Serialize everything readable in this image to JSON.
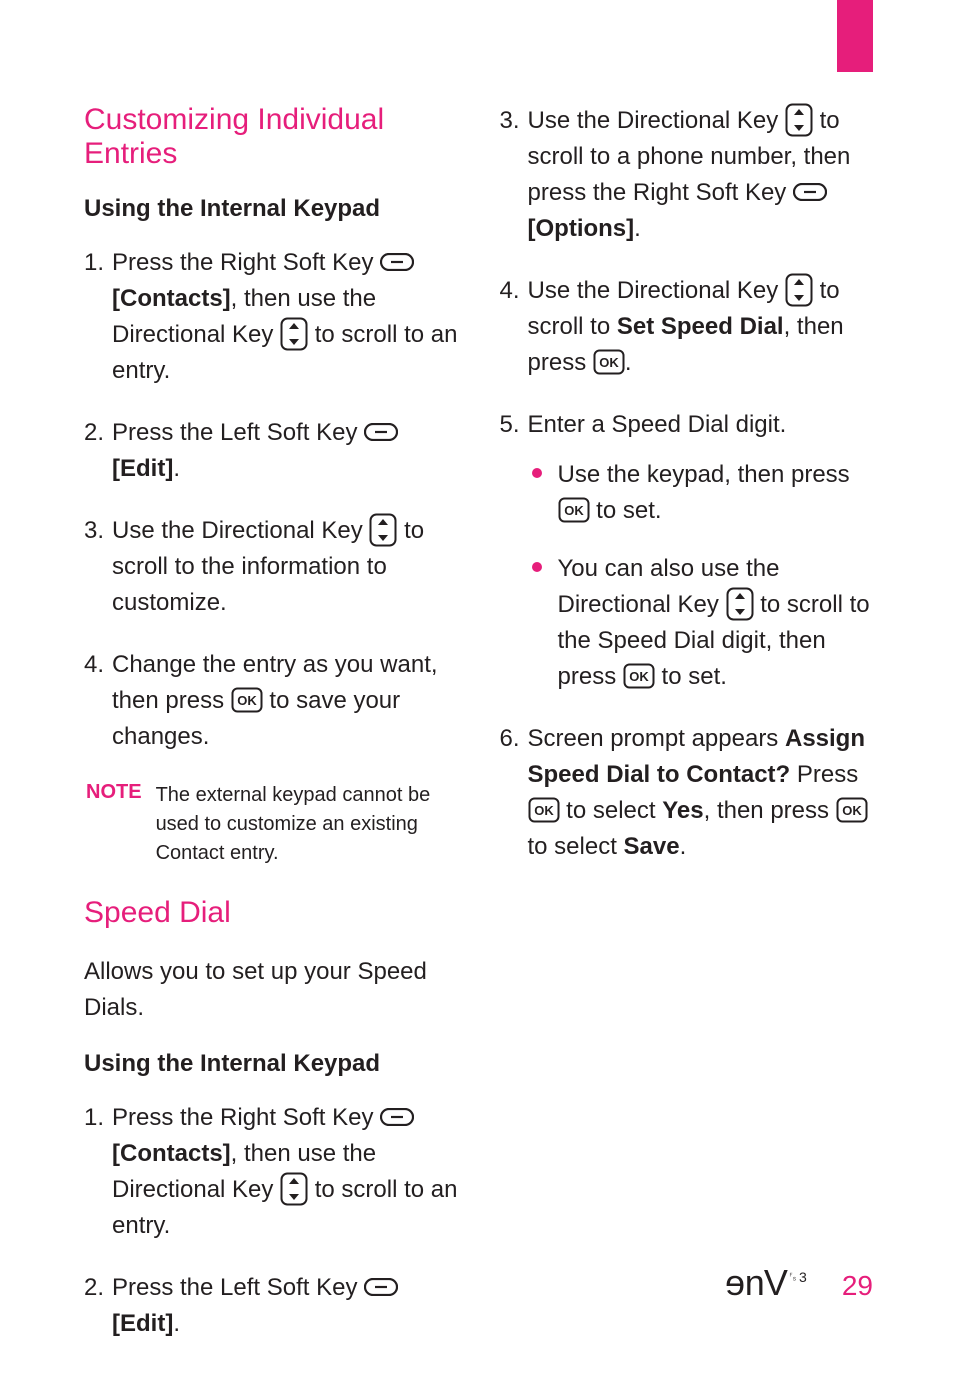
{
  "left": {
    "section1_title": "Customizing Individual Entries",
    "sub1": "Using the Internal Keypad",
    "s1_step1_a": "Press the Right Soft Key ",
    "s1_step1_b": "[Contacts]",
    "s1_step1_c": ", then use the Directional Key ",
    "s1_step1_d": " to scroll to an entry.",
    "s1_step2_a": "Press the Left Soft Key ",
    "s1_step2_b": "[Edit]",
    "s1_step2_c": ".",
    "s1_step3_a": "Use the Directional Key ",
    "s1_step3_b": " to scroll to the information to customize.",
    "s1_step4_a": "Change the entry as you want, then press ",
    "s1_step4_b": " to save your changes.",
    "note_label": "NOTE",
    "note_text": "The external keypad cannot be used to customize an existing Contact entry.",
    "section2_title": "Speed Dial",
    "section2_intro": "Allows you to set up your Speed Dials.",
    "sub2": "Using the Internal Keypad",
    "s2_step1_a": "Press the Right Soft Key ",
    "s2_step1_b": "[Contacts]",
    "s2_step1_c": ", then use the Directional Key ",
    "s2_step1_d": " to scroll to an entry.",
    "s2_step2_a": "Press the Left Soft Key ",
    "s2_step2_b": "[Edit]",
    "s2_step2_c": "."
  },
  "right": {
    "step3_a": "Use the Directional Key ",
    "step3_b": " to scroll to a phone number, then press the Right Soft Key ",
    "step3_c": "[Options]",
    "step3_d": ".",
    "step4_a": "Use the Directional Key ",
    "step4_b": " to scroll to ",
    "step4_c": "Set Speed Dial",
    "step4_d": ", then press ",
    "step4_e": ".",
    "step5": "Enter a Speed Dial digit.",
    "step5_b1_a": "Use the keypad, then press ",
    "step5_b1_b": " to set.",
    "step5_b2_a": "You can also use the Directional Key ",
    "step5_b2_b": " to scroll to the Speed Dial digit, then press ",
    "step5_b2_c": " to set.",
    "step6_a": "Screen prompt appears ",
    "step6_b": "Assign Speed Dial to Contact?",
    "step6_c": " Press ",
    "step6_d": " to select ",
    "step6_e": "Yes",
    "step6_f": ", then press ",
    "step6_g": " to select ",
    "step6_h": "Save",
    "step6_i": "."
  },
  "footer": {
    "page": "29"
  }
}
